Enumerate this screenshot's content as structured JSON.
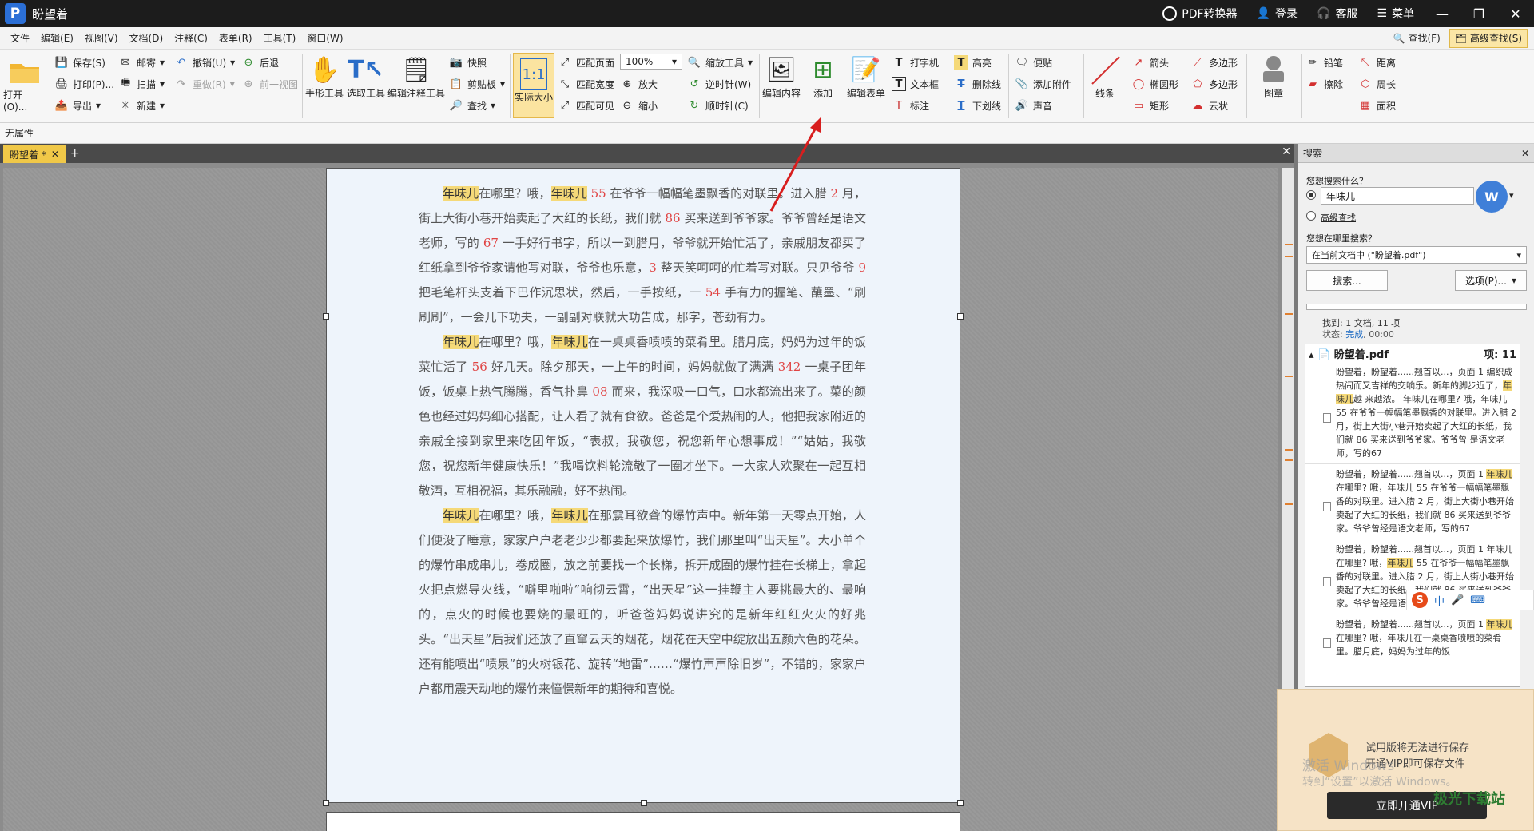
{
  "app": {
    "title": "盼望着",
    "pdf_converter": "PDF转换器",
    "login": "登录",
    "service": "客服",
    "menu": "菜单"
  },
  "menubar": {
    "items": [
      "文件",
      "编辑(E)",
      "视图(V)",
      "文档(D)",
      "注释(C)",
      "表单(R)",
      "工具(T)",
      "窗口(W)"
    ],
    "find": "查找(F)",
    "adv_find": "高级查找(S)"
  },
  "toolbar": {
    "open": "打开(O)...",
    "save": "保存(S)",
    "print": "打印(P)...",
    "export": "导出",
    "mail": "邮寄",
    "scan": "扫描",
    "new": "新建",
    "undo": "撤销(U)",
    "redo": "重做(R)",
    "back": "后退",
    "forward": "前一视图",
    "hand": "手形工具",
    "select": "选取工具",
    "edit_annot": "编辑注释工具",
    "snapshot": "快照",
    "clipboard": "剪贴板",
    "find": "查找",
    "actual": "实际大小",
    "fit_page": "匹配页面",
    "fit_width": "匹配宽度",
    "fit_visible": "匹配可见",
    "zoom_value": "100%",
    "zoom_in": "放大",
    "zoom_out": "缩小",
    "zoom_tool": "缩放工具",
    "ccw": "逆时针(W)",
    "cw": "顺时针(C)",
    "edit_content": "编辑内容",
    "add": "添加",
    "edit_form": "编辑表单",
    "typewriter": "打字机",
    "textbox": "文本框",
    "callout": "标注",
    "highlight": "高亮",
    "strike": "删除线",
    "underline": "下划线",
    "note": "便贴",
    "attach": "添加附件",
    "sound": "声音",
    "line": "线条",
    "arrow": "箭头",
    "ellipse": "椭圆形",
    "rect": "矩形",
    "polygon1": "多边形",
    "polygon2": "多边形",
    "cloud": "云状",
    "stamp": "图章",
    "pencil": "铅笔",
    "eraser": "擦除",
    "distance": "距离",
    "perimeter": "周长",
    "area": "面积"
  },
  "propbar": "无属性",
  "doc_tab": "盼望着 *",
  "document": {
    "paragraphs": [
      [
        {
          "t": "年味儿",
          "h": 1
        },
        {
          "t": "在哪里？哦，"
        },
        {
          "t": "年味儿",
          "h": 1
        },
        {
          "t": " 55 ",
          "n": 1
        },
        {
          "t": "在爷爷一幅幅笔墨飘香的对联里。进入腊 "
        },
        {
          "t": "2",
          "n": 1
        },
        {
          "t": " 月，街上大街小巷开始卖起了大红的长纸，我们就 "
        },
        {
          "t": "86",
          "n": 1
        },
        {
          "t": " 买来送到爷爷家。爷爷曾经是语文老师，写的 "
        },
        {
          "t": "67",
          "n": 1
        },
        {
          "t": " 一手好行书字，所以一到腊月，爷爷就开始忙活了，亲戚朋友都买了红纸拿到爷爷家请他写对联，爷爷也乐意，"
        },
        {
          "t": "3",
          "n": 1
        },
        {
          "t": " 整天笑呵呵的忙着写对联。只见爷爷 "
        },
        {
          "t": "9",
          "n": 1
        },
        {
          "t": " 把毛笔杆头支着下巴作沉思状，然后，一手按纸，一 "
        },
        {
          "t": "54",
          "n": 1
        },
        {
          "t": " 手有力的握笔、蘸墨、“刷刷刷”，一会儿下功夫，一副副对联就大功告成，那字，苍劲有力。"
        }
      ],
      [
        {
          "t": "年味儿",
          "h": 1
        },
        {
          "t": "在哪里？哦，"
        },
        {
          "t": "年味儿",
          "h": 1
        },
        {
          "t": "在一桌桌香喷喷的菜肴里。腊月底，妈妈为过年的饭菜忙活了 "
        },
        {
          "t": "56",
          "n": 1
        },
        {
          "t": " 好几天。除夕那天，一上午的时间，妈妈就做了满满 "
        },
        {
          "t": "342",
          "n": 1
        },
        {
          "t": " 一桌子团年饭，饭桌上热气腾腾，香气扑鼻 "
        },
        {
          "t": "08",
          "n": 1
        },
        {
          "t": " 而来，我深吸一口气，口水都流出来了。菜的颜色也经过妈妈细心搭配，让人看了就有食欲。爸爸是个爱热闹的人，他把我家附近的亲戚全接到家里来吃团年饭，“表叔，我敬您，祝您新年心想事成！”“姑姑，我敬您，祝您新年健康快乐！”我喝饮料轮流敬了一圈才坐下。一大家人欢聚在一起互相敬酒，互相祝福，其乐融融，好不热闹。"
        }
      ],
      [
        {
          "t": "年味儿",
          "h": 1
        },
        {
          "t": "在哪里？哦，"
        },
        {
          "t": "年味儿",
          "h": 1
        },
        {
          "t": "在那震耳欲聋的爆竹声中。新年第一天零点开始，人们便没了睡意，家家户户老老少少都要起来放爆竹，我们那里叫“出天星”。大小单个的爆竹串成串儿，卷成圈，放之前要找一个长梯，拆开成圈的爆竹挂在长梯上，拿起火把点燃导火线，“噼里啪啦”响彻云霄，“出天星”这一挂鞭主人要挑最大的、最响的，点火的时候也要烧的最旺的，听爸爸妈妈说讲究的是新年红红火火的好兆头。“出天星”后我们还放了直窜云天的烟花，烟花在天空中绽放出五颜六色的花朵。还有能喷出“喷泉”的火树银花、旋转“地雷”……“爆竹声声除旧岁”，不错的，家家户户都用震天动地的爆竹来憧憬新年的期待和喜悦。"
        }
      ]
    ]
  },
  "search": {
    "panel_title": "搜索",
    "what_label": "您想搜索什么？",
    "query": "年味儿",
    "advanced": "高级查找",
    "where_label": "您想在哪里搜索？",
    "where_value": "在当前文档中 (\"盼望着.pdf\")",
    "search_btn": "搜索...",
    "options_btn": "选项(P)...",
    "found": "找到: 1 文档, 11 项",
    "status_label": "状态: ",
    "status_value": "完成",
    "status_time": ", 00:00",
    "file": "盼望着.pdf",
    "count_label": "项: 11",
    "results": [
      [
        {
          "t": "盼望着，盼望着......翘首以...，页面 1 编织成热闹而又吉祥的交响乐。新年的脚步近了，"
        },
        {
          "t": "年味儿",
          "h": 1
        },
        {
          "t": "越 来越浓。 年味儿在哪里? 哦，年味儿 55 在爷爷一幅幅笔墨飘香的对联里。进入腊 2 月，街上大街小巷开始卖起了大红的长纸，我们就 86 买来送到爷爷家。爷爷曾 是语文老师，写的67"
        }
      ],
      [
        {
          "t": "盼望着，盼望着......翘首以...，页面 1 "
        },
        {
          "t": "年味儿",
          "h": 1
        },
        {
          "t": "在哪里? 哦，年味儿 55 在爷爷一幅幅笔墨飘香的对联里。进入腊 2 月，街上大街小巷开始卖起了大红的长纸，我们就 86 买来送到爷爷家。爷爷曾经是语文老师，写的67"
        }
      ],
      [
        {
          "t": "盼望着，盼望着......翘首以...，页面 1 年味儿在哪里? 哦，"
        },
        {
          "t": "年味儿",
          "h": 1
        },
        {
          "t": " 55 在爷爷一幅幅笔墨飘香的对联里。进入腊 2 月，街上大街小巷开始卖起了大红的长纸，我们就 86 买来送到爷爷家。爷爷曾经是语文老师，写的67"
        }
      ],
      [
        {
          "t": "盼望着，盼望着......翘首以...，页面 1 "
        },
        {
          "t": "年味儿",
          "h": 1
        },
        {
          "t": "在哪里? 哦，年味儿在一桌桌香喷喷的菜肴里。腊月底，妈妈为过年的饭"
        }
      ]
    ]
  },
  "vip": {
    "line1": "试用版将无法进行保存",
    "line2": "开通VIP即可保存文件",
    "button": "立即开通VIP"
  },
  "overlay": {
    "win1": "激活 Windows",
    "win2": "转到“设置”以激活 Windows。",
    "ime": "中",
    "site": "极光下载站"
  }
}
